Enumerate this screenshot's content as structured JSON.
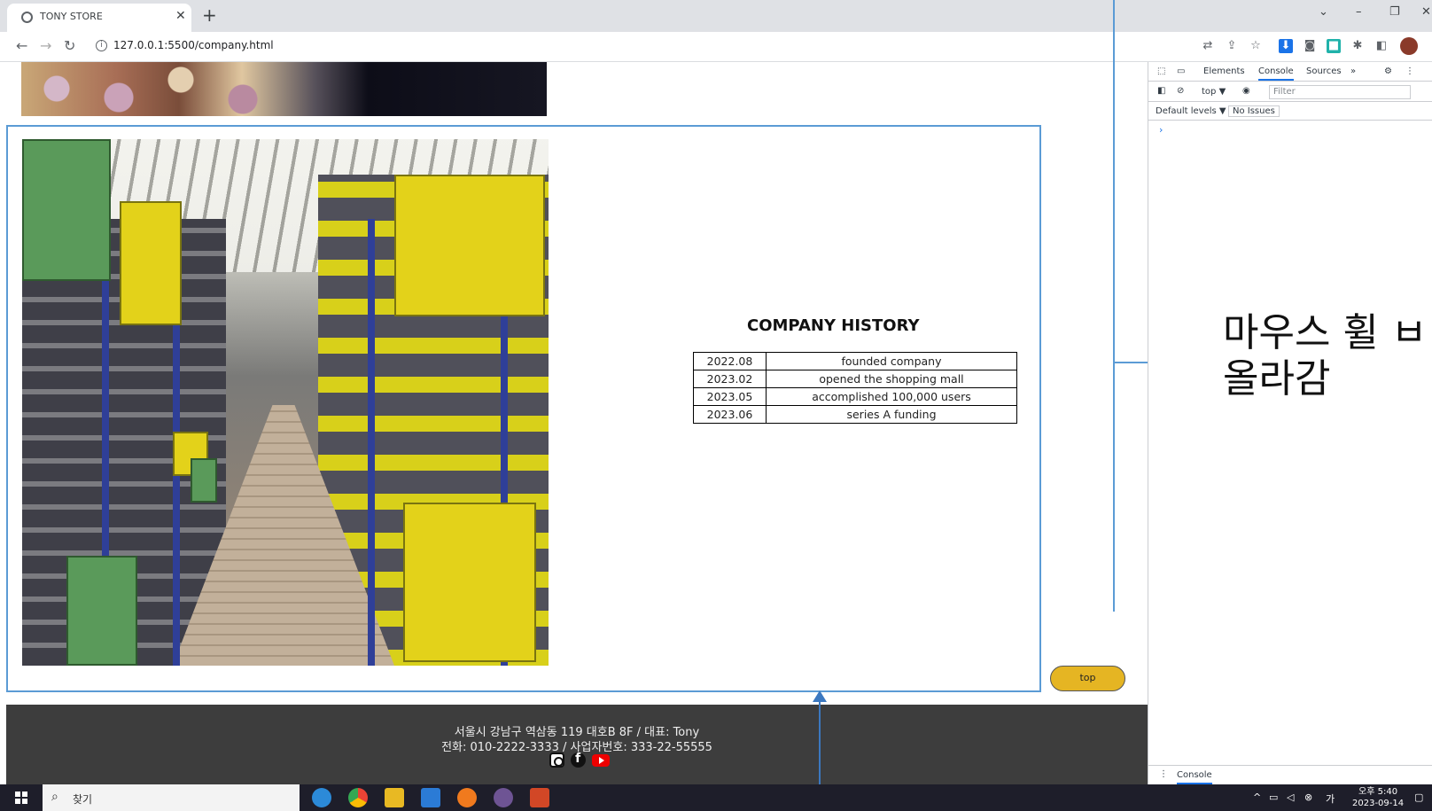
{
  "browser": {
    "tab_title": "TONY STORE",
    "tab_close": "✕",
    "new_tab": "+",
    "url": "127.0.0.1:5500/company.html",
    "window_controls": [
      "⌄",
      "–",
      "❐",
      "✕"
    ]
  },
  "page": {
    "history_title": "COMPANY HISTORY",
    "history": [
      {
        "date": "2022.08",
        "event": "founded company"
      },
      {
        "date": "2023.02",
        "event": "opened the shopping mall"
      },
      {
        "date": "2023.05",
        "event": "accomplished 100,000 users"
      },
      {
        "date": "2023.06",
        "event": "series A funding"
      }
    ],
    "top_button": "top",
    "footer": {
      "address": "서울시 강남구 역삼동 119 대호B 8F / 대표: Tony",
      "contact": "전화: 010-2222-3333 / 사업자번호: 333-22-55555"
    }
  },
  "devtools": {
    "tabs": [
      "Elements",
      "Console",
      "Sources",
      "»"
    ],
    "context": "top ▼",
    "filter_placeholder": "Filter",
    "default_levels": "Default levels ▼",
    "issues": "No Issues",
    "prompt": "›",
    "drawer_tab": "Console"
  },
  "annotation": {
    "note": "마우스 휠 ㅂ\n올라감"
  },
  "taskbar": {
    "search_label": "찾기",
    "time": "오후 5:40",
    "date": "2023-09-14"
  },
  "colors": {
    "accent_border": "#5b9bd5",
    "top_button": "#e5b523",
    "footer_bg": "#3d3d3d"
  }
}
